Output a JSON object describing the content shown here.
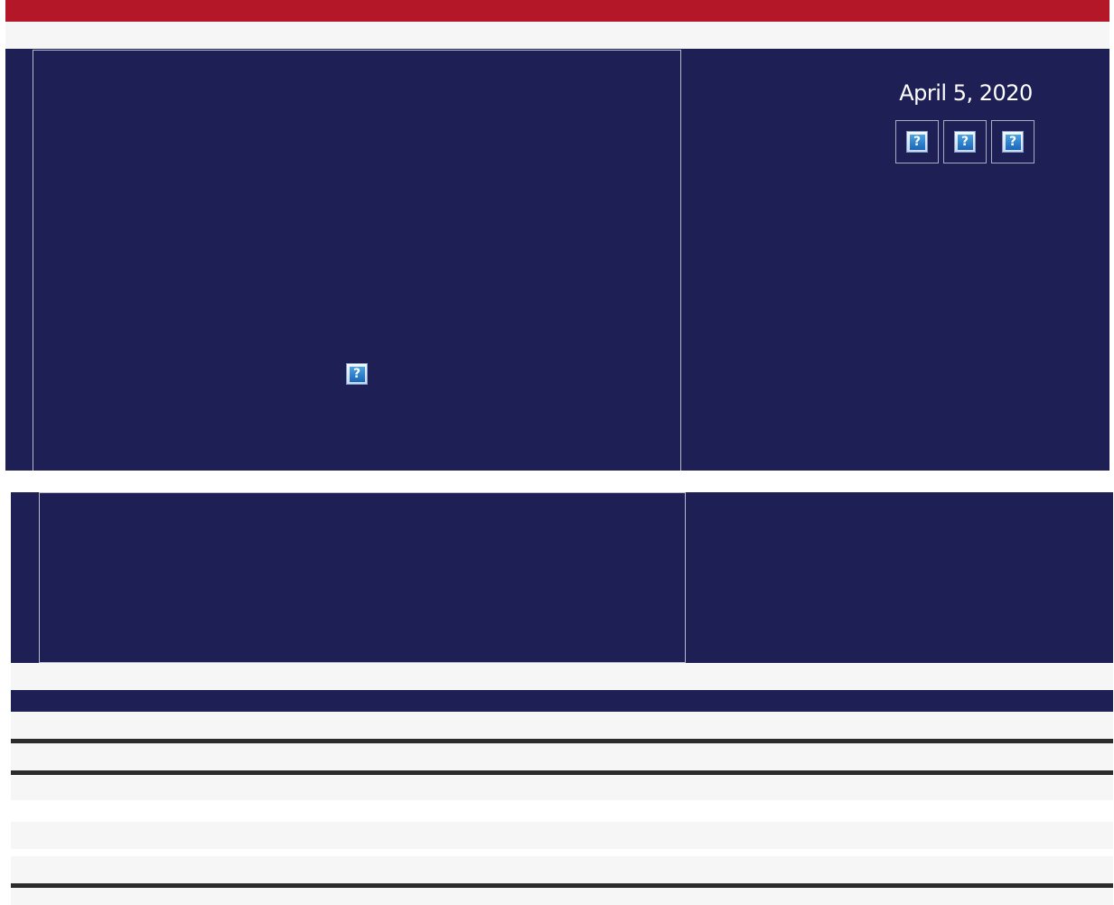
{
  "header": {
    "date": "April 5, 2020"
  },
  "icons": {
    "social": [
      "missing-image-icon",
      "missing-image-icon",
      "missing-image-icon"
    ],
    "center": "missing-image-icon",
    "glyph": "?"
  },
  "colors": {
    "brand_red": "#b31728",
    "navy": "#1d1f55",
    "light_gray": "#f6f6f6",
    "rule": "#2b2b2b"
  }
}
